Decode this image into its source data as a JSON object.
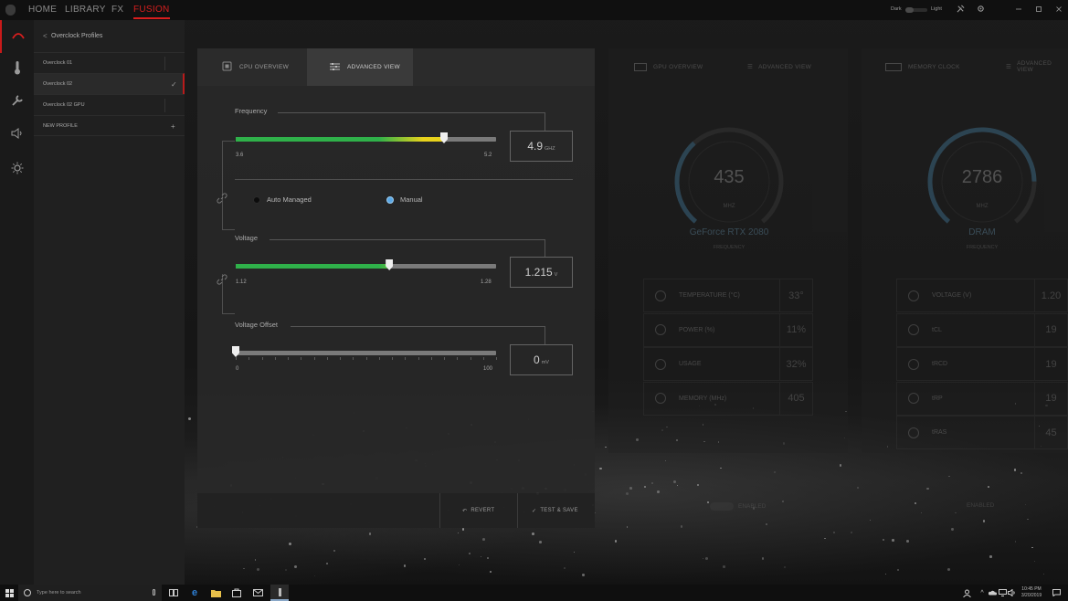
{
  "topbar": {
    "nav": [
      "HOME",
      "LIBRARY",
      "FX",
      "FUSION"
    ],
    "active_nav": "FUSION",
    "theme_dark": "Dark",
    "theme_light": "Light"
  },
  "rail": {
    "icons": [
      "fusion-icon",
      "thermometer-icon",
      "wrench-icon",
      "speaker-icon",
      "brightness-icon"
    ]
  },
  "profiles": {
    "title": "Overclock Profiles",
    "back": "<",
    "items": [
      "Overclock 01",
      "Overclock 02",
      "Overclock 02 GPU"
    ],
    "selected": "Overclock 02",
    "checkmark": "✓",
    "new_profile": "NEW PROFILE",
    "add": "+"
  },
  "cpu": {
    "tab_overview": "CPU OVERVIEW",
    "tab_advanced": "ADVANCED VIEW",
    "frequency": {
      "label": "Frequency",
      "min": "3.6",
      "max": "5.2",
      "value": "4.9",
      "unit": "GHZ",
      "level": 0.8
    },
    "mode": {
      "auto": "Auto Managed",
      "manual": "Manual",
      "selected": "Manual"
    },
    "voltage": {
      "label": "Voltage",
      "min": "1.12",
      "max": "1.28",
      "value": "1.215",
      "unit": "V",
      "level": 0.59
    },
    "offset": {
      "label": "Voltage Offset",
      "min": "0",
      "max": "100",
      "value": "0",
      "unit": "mV",
      "level": 0.0
    },
    "revert": "REVERT",
    "test_save": "TEST & SAVE",
    "revert_icon": "↶",
    "save_icon": "✓"
  },
  "gpu": {
    "tab_overview": "GPU OVERVIEW",
    "tab_advanced": "ADVANCED VIEW",
    "gauge_value": "435",
    "gauge_unit": "MHZ",
    "name": "GeForce RTX 2080",
    "sub": "FREQUENCY",
    "level": 0.35,
    "metrics": [
      {
        "label": "TEMPERATURE (°C)",
        "value": "33°",
        "icon": "thermometer-icon"
      },
      {
        "label": "POWER (%)",
        "value": "11%",
        "icon": "wrench-icon"
      },
      {
        "label": "USAGE",
        "value": "32%",
        "icon": "gauge-icon"
      },
      {
        "label": "MEMORY (MHz)",
        "value": "405",
        "icon": "memory-icon"
      }
    ],
    "enabled": "ENABLED"
  },
  "memory": {
    "tab_overview": "MEMORY CLOCK",
    "tab_advanced": "ADVANCED VIEW",
    "gauge_value": "2786",
    "gauge_unit": "MHZ",
    "name": "DRAM",
    "sub": "FREQUENCY",
    "level": 0.82,
    "metrics": [
      {
        "label": "VOLTAGE (V)",
        "value": "1.20",
        "icon": "bolt-icon"
      },
      {
        "label": "tCL",
        "value": "19",
        "icon": "gauge-icon"
      },
      {
        "label": "tRCD",
        "value": "19",
        "icon": "gauge-icon"
      },
      {
        "label": "tRP",
        "value": "19",
        "icon": "gauge-icon"
      },
      {
        "label": "tRAS",
        "value": "45",
        "icon": "gauge-icon"
      }
    ],
    "enabled": "ENABLED"
  },
  "taskbar": {
    "search_placeholder": "Type here to search",
    "time": "10:45 PM",
    "date": "3/20/2019"
  },
  "colors": {
    "accent": "#d81e1e",
    "gauge": "#3f6f8c",
    "slider_green": "#2fb14a",
    "slider_yellow": "#e8d21c",
    "manual_dot": "#5aa8e6"
  }
}
